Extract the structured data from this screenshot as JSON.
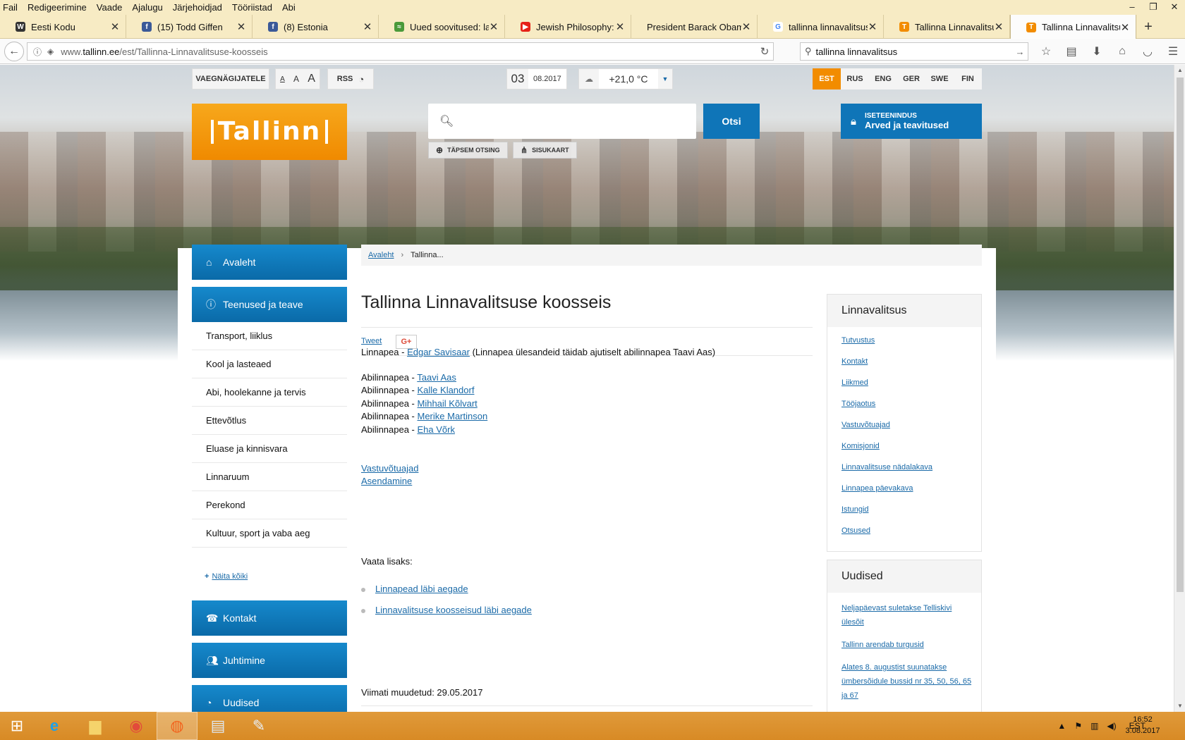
{
  "menu": [
    "Fail",
    "Redigeerimine",
    "Vaade",
    "Ajalugu",
    "Järjehoidjad",
    "Tööriistad",
    "Abi"
  ],
  "tabs": [
    {
      "title": "Eesti Kodu",
      "icon": "W",
      "color": "#333333"
    },
    {
      "title": "(15) Todd Giffen",
      "icon": "f",
      "color": "#3b5998"
    },
    {
      "title": "(8) Estonia",
      "icon": "f",
      "color": "#3b5998"
    },
    {
      "title": "Uued soovitused: laste",
      "icon": "≈",
      "color": "#4a9a3a"
    },
    {
      "title": "Jewish Philosophy: Dav",
      "icon": "▶",
      "color": "#e62117"
    },
    {
      "title": "President Barack Obama's",
      "icon": "",
      "color": "#f7ebc4"
    },
    {
      "title": "tallinna linnavalitsus -",
      "icon": "G",
      "color": "#4285f4"
    },
    {
      "title": "Tallinna Linnavalitsuse",
      "icon": "T",
      "color": "#f28c00"
    },
    {
      "title": "Tallinna Linnavalitsuse",
      "icon": "T",
      "color": "#f28c00",
      "active": true
    }
  ],
  "url": {
    "prefix": "www.",
    "domain": "tallinn.ee",
    "path": "/est/Tallinna-Linnavalitsuse-koosseis"
  },
  "browser_search": "tallinna linnavalitsus",
  "site": {
    "vaegnagijatele": "VAEGNÄGIJATELE",
    "font_sizes": [
      "A",
      "A",
      "A"
    ],
    "rss": "RSS",
    "date_day": "03",
    "date_month": "08.2017",
    "temperature": "+21,0 °C",
    "languages": [
      "EST",
      "RUS",
      "ENG",
      "GER",
      "SWE",
      "FIN"
    ],
    "logo": "Tallinn",
    "search_button": "Otsi",
    "advanced_search": "TÄPSEM OTSING",
    "sitemap": "SISUKAART",
    "iseteenindus_l1": "ISETEENINDUS",
    "iseteenindus_l2": "Arved ja teavitused"
  },
  "left_nav": {
    "avaleht": "Avaleht",
    "teenused": "Teenused ja teave",
    "sub": [
      "Transport, liiklus",
      "Kool ja lasteaed",
      "Abi, hoolekanne ja tervis",
      "Ettevõtlus",
      "Eluase ja kinnisvara",
      "Linnaruum",
      "Perekond",
      "Kultuur, sport ja vaba aeg"
    ],
    "show_all": "Näita kõiki",
    "kontakt": "Kontakt",
    "juhtimine": "Juhtimine",
    "uudised": "Uudised"
  },
  "breadcrumb": {
    "home": "Avaleht",
    "current": "Tallinna..."
  },
  "article": {
    "title": "Tallinna Linnavalitsuse koosseis",
    "tweet": "Tweet",
    "gplus": "G+",
    "mayor_label": "Linnapea - ",
    "mayor_name": "Edgar Savisaar",
    "mayor_note": " (Linnapea ülesandeid täidab ajutiselt abilinnapea Taavi Aas)",
    "deputy_label": "Abilinnapea - ",
    "deputies": [
      "Taavi Aas",
      "Kalle Klandorf",
      "Mihhail Kõlvart",
      "Merike Martinson",
      "Eha Võrk"
    ],
    "link_vastuvotuajad": "Vastuvõtuajad",
    "link_asendamine": "Asendamine",
    "see_also": "Vaata lisaks:",
    "see_also_links": [
      "Linnapead läbi aegade",
      "Linnavalitsuse koosseisud läbi aegade"
    ],
    "modified": "Viimati muudetud: 29.05.2017"
  },
  "right_box_linnavalitsus": {
    "title": "Linnavalitsus",
    "links": [
      "Tutvustus",
      "Kontakt",
      "Liikmed",
      "Tööjaotus",
      "Vastuvõtuajad",
      "Komisjonid",
      "Linnavalitsuse nädalakava",
      "Linnapea päevakava",
      "Istungid",
      "Otsused"
    ]
  },
  "right_box_uudised": {
    "title": "Uudised",
    "items": [
      "Neljapäevast suletakse Telliskivi ülesõit",
      "Tallinn arendab turgusid",
      "Alates 8. augustist suunatakse ümbersõidule bussid nr 35, 50, 56, 65 ja 67"
    ]
  },
  "tray": {
    "lang": "EST",
    "time": "16:52",
    "date": "3.08.2017"
  }
}
